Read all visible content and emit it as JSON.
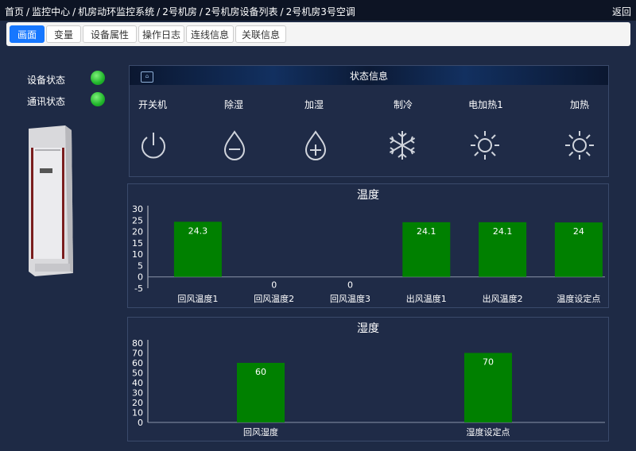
{
  "breadcrumb": [
    "首页",
    "监控中心",
    "机房动环监控系统",
    "2号机房",
    "2号机房设备列表",
    "2号机房3号空调"
  ],
  "back_label": "返回",
  "tabs": [
    {
      "label": "画面",
      "active": true
    },
    {
      "label": "变量",
      "active": false
    },
    {
      "label": "设备属性",
      "active": false
    },
    {
      "label": "操作日志",
      "active": false
    },
    {
      "label": "连线信息",
      "active": false
    },
    {
      "label": "关联信息",
      "active": false
    }
  ],
  "device_status": {
    "label": "设备状态",
    "color": "#22c22e"
  },
  "comm_status": {
    "label": "通讯状态",
    "color": "#22c22e"
  },
  "status_panel": {
    "title": "状态信息",
    "items": [
      {
        "label": "开关机",
        "icon": "power-icon"
      },
      {
        "label": "除湿",
        "icon": "drop-minus-icon"
      },
      {
        "label": "加湿",
        "icon": "drop-plus-icon"
      },
      {
        "label": "制冷",
        "icon": "snowflake-icon"
      },
      {
        "label": "电加热1",
        "icon": "sun-icon"
      },
      {
        "label": "加热",
        "icon": "sun-icon"
      }
    ]
  },
  "chart_data": [
    {
      "type": "bar",
      "title": "温度",
      "categories": [
        "回风温度1",
        "回风温度2",
        "回风温度3",
        "出风温度1",
        "出风温度2",
        "温度设定点"
      ],
      "values": [
        24.3,
        0,
        0,
        24.1,
        24.1,
        24
      ],
      "ylim": [
        -5,
        30
      ],
      "yticks": [
        30,
        25,
        20,
        15,
        10,
        5,
        0,
        -5
      ],
      "bar_color": "#008000"
    },
    {
      "type": "bar",
      "title": "湿度",
      "categories": [
        "回风湿度",
        "湿度设定点"
      ],
      "values": [
        60,
        70
      ],
      "ylim": [
        0,
        80
      ],
      "yticks": [
        80,
        70,
        60,
        50,
        40,
        30,
        20,
        10,
        0
      ],
      "bar_color": "#008000"
    }
  ]
}
